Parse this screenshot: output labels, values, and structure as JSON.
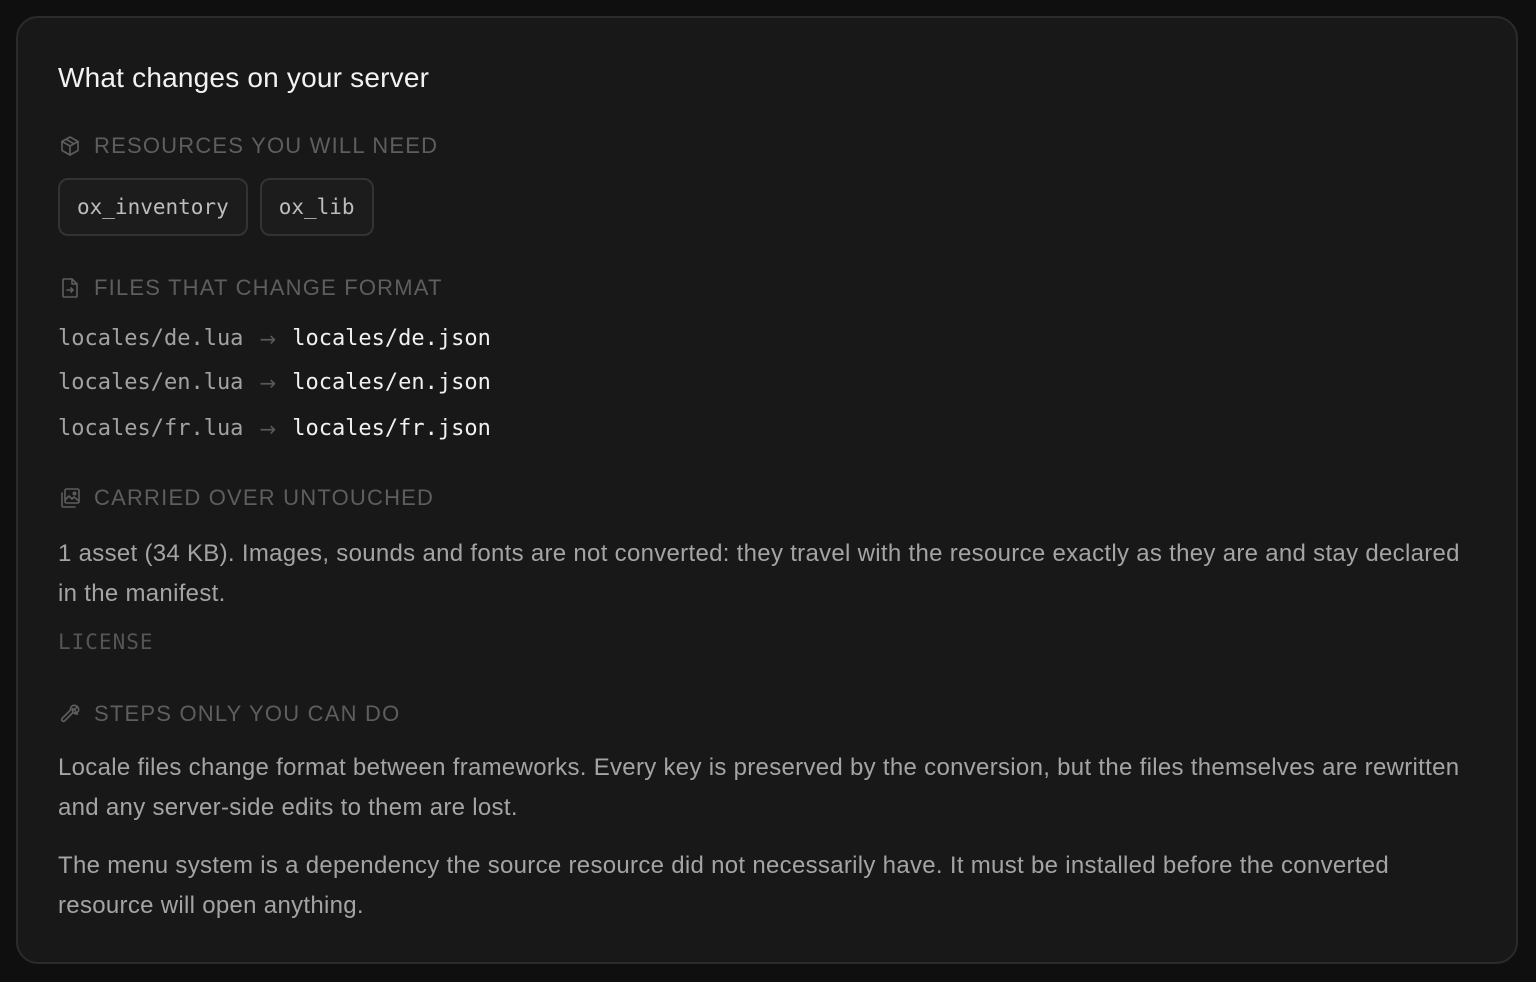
{
  "card": {
    "title": "What changes on your server"
  },
  "resources": {
    "heading": "RESOURCES YOU WILL NEED",
    "icon": "package-icon",
    "items": [
      "ox_inventory",
      "ox_lib"
    ]
  },
  "files": {
    "heading": "FILES THAT CHANGE FORMAT",
    "icon": "file-convert-icon",
    "arrow": "→",
    "rows": [
      {
        "from": "locales/de.lua",
        "to": "locales/de.json"
      },
      {
        "from": "locales/en.lua",
        "to": "locales/en.json"
      },
      {
        "from": "locales/fr.lua",
        "to": "locales/fr.json"
      }
    ]
  },
  "carried": {
    "heading": "CARRIED OVER UNTOUCHED",
    "icon": "images-icon",
    "text": "1 asset (34 KB). Images, sounds and fonts are not converted: they travel with the resource exactly as they are and stay declared in the manifest.",
    "license": "LICENSE"
  },
  "steps": {
    "heading": "STEPS ONLY YOU CAN DO",
    "icon": "wrench-icon",
    "paragraphs": [
      "Locale files change format between frameworks. Every key is preserved by the conversion, but the files themselves are rewritten and any server-side edits to them are lost.",
      "The menu system is a dependency the source resource did not necessarily have. It must be installed before the converted resource will open anything."
    ]
  },
  "colors": {
    "background": "#0f0f0f",
    "card": "#181818",
    "border": "#2b2b2b",
    "heading": "#5e5e5e",
    "text": "#a4a4a4",
    "title": "#f2f2f2"
  }
}
